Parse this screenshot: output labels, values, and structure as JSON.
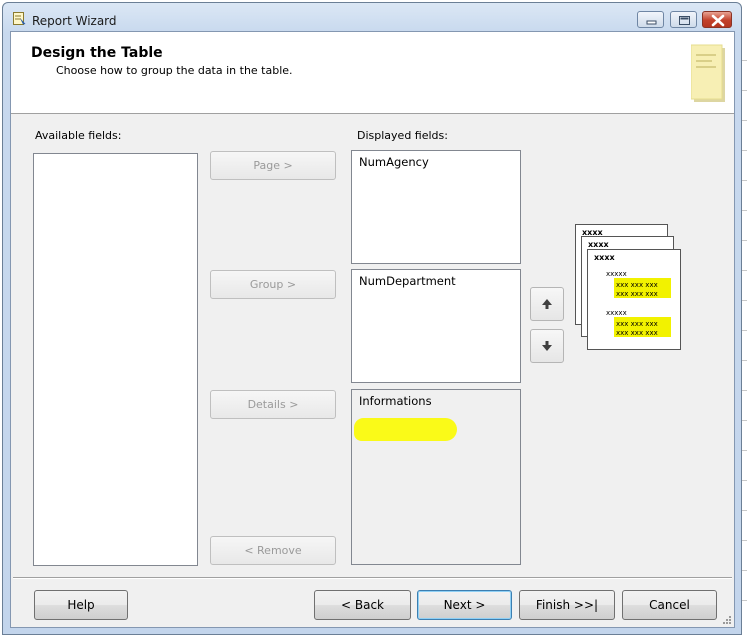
{
  "window": {
    "title": "Report Wizard"
  },
  "header": {
    "title": "Design the Table",
    "subtitle": "Choose how to group the data in the table."
  },
  "available": {
    "label": "Available fields:",
    "items": []
  },
  "displayed": {
    "label": "Displayed fields:",
    "page_items": [
      "NumAgency"
    ],
    "group_items": [
      "NumDepartment"
    ],
    "details_items": [
      "Informations"
    ]
  },
  "move_buttons": {
    "page": "Page >",
    "group": "Group >",
    "details": "Details >",
    "remove": "< Remove"
  },
  "preview": {
    "level1": "xxxx",
    "level2": "xxxx",
    "level3": "xxxx",
    "detail_header": "xxxxx",
    "detail_row": "xxx xxx xxx"
  },
  "footer": {
    "help": "Help",
    "back": "< Back",
    "next": "Next >",
    "finish": "Finish >>|",
    "cancel": "Cancel"
  },
  "colors": {
    "highlight": "#fbfb00",
    "accent": "#3c7fb1"
  }
}
